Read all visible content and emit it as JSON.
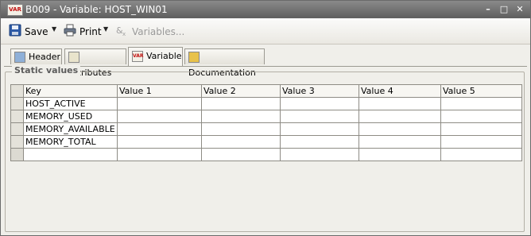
{
  "window": {
    "icon_text": "VAR",
    "title": "B009 - Variable: HOST_WIN01",
    "minimize_glyph": "–",
    "maximize_glyph": "□",
    "close_glyph": "✕"
  },
  "toolbar": {
    "save_label": "Save",
    "print_label": "Print",
    "variables_label": "Variables..."
  },
  "tabs": [
    {
      "label": "Header",
      "icon": "header-icon"
    },
    {
      "label": "Attributes",
      "icon": "attributes-icon"
    },
    {
      "label": "Variable",
      "icon": "var-icon",
      "icon_text": "VAR",
      "active": true
    },
    {
      "label": "Documentation",
      "icon": "documentation-icon"
    }
  ],
  "static_values": {
    "group_title": "Static values",
    "columns": [
      "Key",
      "Value 1",
      "Value 2",
      "Value 3",
      "Value 4",
      "Value 5"
    ],
    "rows": [
      [
        "HOST_ACTIVE",
        "",
        "",
        "",
        "",
        ""
      ],
      [
        "MEMORY_USED",
        "",
        "",
        "",
        "",
        ""
      ],
      [
        "MEMORY_AVAILABLE",
        "",
        "",
        "",
        "",
        ""
      ],
      [
        "MEMORY_TOTAL",
        "",
        "",
        "",
        "",
        ""
      ],
      [
        "",
        "",
        "",
        "",
        "",
        ""
      ]
    ]
  },
  "colors": {
    "titlebar": "#6e6e6e",
    "window_bg": "#f0efea",
    "grid_border": "#8e8c85"
  }
}
